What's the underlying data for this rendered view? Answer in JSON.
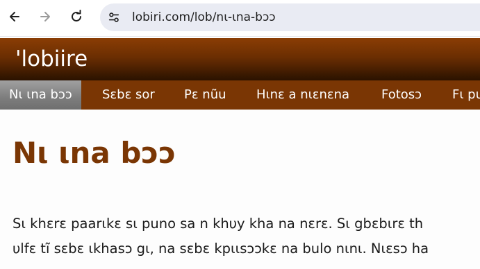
{
  "browser": {
    "url": "lobiri.com/lob/nι-ιna-bɔɔ"
  },
  "site": {
    "title": "'lobiire"
  },
  "nav": {
    "items": [
      {
        "label": "Nι ιna bɔɔ",
        "active": true
      },
      {
        "label": "Sɛbɛ sor"
      },
      {
        "label": "Pɛ nũu"
      },
      {
        "label": "Hιnɛ a nιɛnɛna"
      },
      {
        "label": "Fotosɔ"
      },
      {
        "label": "Fι pu"
      }
    ]
  },
  "page": {
    "heading": "Nι ιna bɔɔ",
    "paragraph_lines": [
      "Sι khɛrɛ paarιkɛ sι puno sa n khυy kha na nɛrɛ. Sι gbɛbιrɛ th",
      "υlfɛ tĩ sɛbɛ ιkhasɔ gι, na sɛbɛ kpιιsɔɔkɛ na bulo nιnι. Nιɛsɔ ha"
    ]
  },
  "colors": {
    "brand": "#7a3604",
    "heading": "#7a3604",
    "active_tab": "#8c8c8c"
  }
}
